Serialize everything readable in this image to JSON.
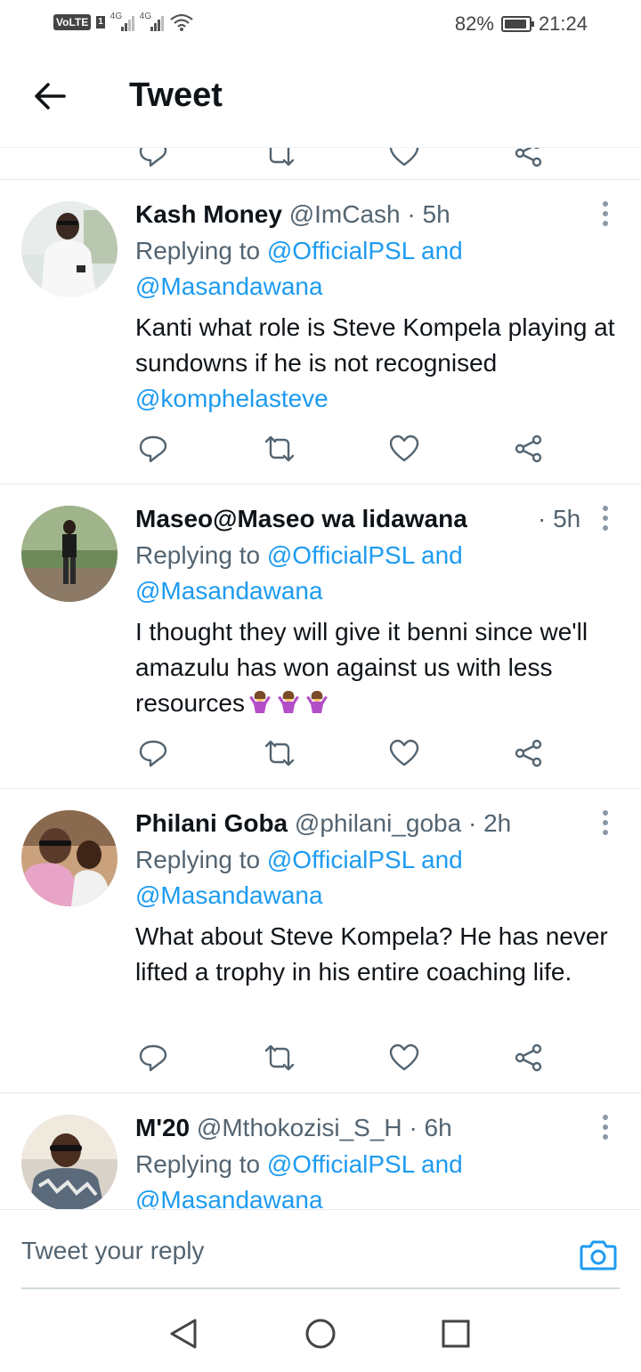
{
  "status_bar": {
    "volte": "VoLTE",
    "sim": "1",
    "network1": "4G",
    "network2": "4G",
    "battery": "82%",
    "time": "21:24"
  },
  "header": {
    "title": "Tweet"
  },
  "tweets": [
    {
      "name": "Kash Money",
      "handle": "@ImCash",
      "sep": "·",
      "time": "5h",
      "replying_prefix": "Replying to",
      "reply_to_1": "@OfficialPSL",
      "reply_and": "and",
      "reply_to_2": "@Masandawana",
      "text": "Kanti what role is Steve Kompela playing at sundowns if he is not recognised",
      "mention": "@komphelasteve"
    },
    {
      "name": "Maseo@Maseo wa lidawana",
      "handle": "",
      "sep": "·",
      "time": "5h",
      "replying_prefix": "Replying to",
      "reply_to_1": "@OfficialPSL",
      "reply_and": "and",
      "reply_to_2": "@Masandawana",
      "text": "I thought they will give it benni since we'll amazulu has won against us with less resources",
      "emoji": "🤷‍♀️🤷‍♀️🤷‍♀️"
    },
    {
      "name": "Philani Goba",
      "handle": "@philani_goba",
      "sep": "·",
      "time": "2h",
      "replying_prefix": "Replying to",
      "reply_to_1": "@OfficialPSL",
      "reply_and": "and",
      "reply_to_2": "@Masandawana",
      "text": "What about Steve Kompela? He has never lifted a trophy in his entire coaching life."
    },
    {
      "name": "M'20",
      "handle": "@Mthokozisi_S_H",
      "sep": "·",
      "time": "6h",
      "replying_prefix": "Replying to",
      "reply_to_1": "@OfficialPSL",
      "reply_and": "and",
      "reply_to_2": "@Masandawana"
    }
  ],
  "composer": {
    "placeholder": "Tweet your reply"
  },
  "icons": {
    "back": "arrow-left-icon",
    "more": "more-vertical-icon",
    "reply": "reply-icon",
    "retweet": "retweet-icon",
    "like": "heart-icon",
    "share": "share-icon",
    "camera": "camera-icon",
    "nav_back": "triangle-back-icon",
    "nav_home": "circle-home-icon",
    "nav_recent": "square-recents-icon"
  },
  "colors": {
    "link": "#1d9bf0",
    "text": "#0f1419",
    "secondary": "#536471"
  }
}
